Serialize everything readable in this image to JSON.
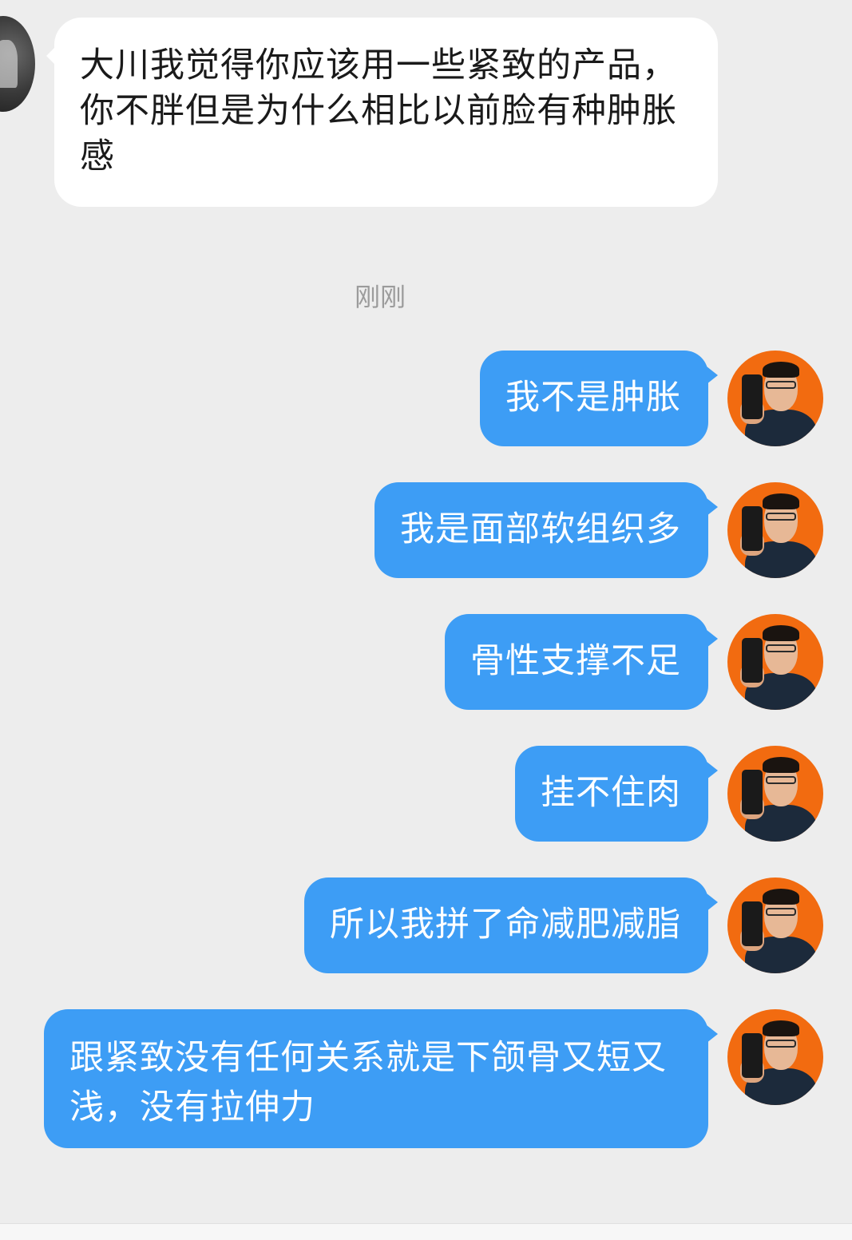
{
  "incoming": {
    "text": "大川我觉得你应该用一些紧致的产品，你不胖但是为什么相比以前脸有种肿胀感"
  },
  "timestamp": "刚刚",
  "outgoing": [
    {
      "text": "我不是肿胀"
    },
    {
      "text": "我是面部软组织多"
    },
    {
      "text": "骨性支撑不足"
    },
    {
      "text": "挂不住肉"
    },
    {
      "text": "所以我拼了命减肥减脂"
    },
    {
      "text": "跟紧致没有任何关系就是下颌骨又短又浅，没有拉伸力"
    }
  ],
  "colors": {
    "background": "#ededed",
    "incoming_bubble": "#ffffff",
    "outgoing_bubble": "#3d9df5",
    "avatar_bg": "#f26b10"
  }
}
